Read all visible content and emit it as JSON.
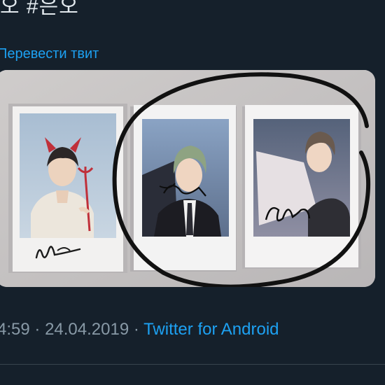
{
  "tweet": {
    "text_partial": "오 #은오",
    "translate_label": "Перевести твит",
    "time": "4:59",
    "separator": "·",
    "date": "24.04.2019",
    "source": "Twitter for Android"
  },
  "colors": {
    "background": "#15202b",
    "link": "#1da1f2",
    "secondary_text": "#8899a6",
    "divider": "#38444d"
  },
  "media": {
    "type": "photo",
    "photocards": [
      "photocard-left",
      "photocard-middle",
      "photocard-right"
    ]
  }
}
